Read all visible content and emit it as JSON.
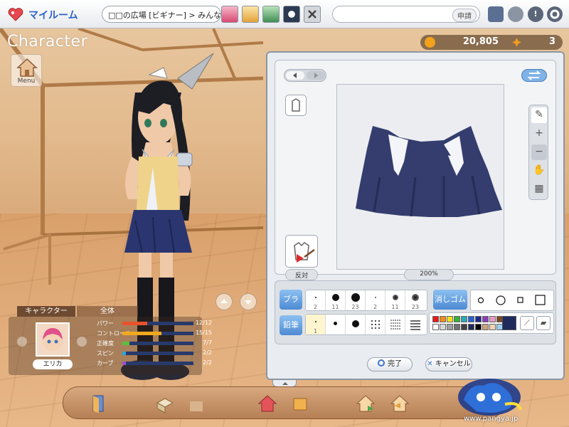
{
  "topbar": {
    "myroom_label": "マイルーム",
    "room_name": "□□の広場 [ビギナー] > みんなで大...",
    "apply_label": "申請"
  },
  "title": "Character",
  "menu_label": "Menu",
  "currency": {
    "pang": "20,805",
    "cookie": "3"
  },
  "editor": {
    "mirror_label": "反対",
    "zoom_label": "200%",
    "brush_tab": "ブラシ",
    "eraser_tab": "消しゴム",
    "pencil_tab": "鉛筆",
    "brush_sizes": [
      "2",
      "11",
      "23",
      "2",
      "11",
      "23"
    ],
    "pencil_sizes": [
      "1"
    ],
    "ok_label": "完了",
    "cancel_label": "キャンセル",
    "palette_colors": [
      "#e41c1c",
      "#f28c1b",
      "#f6e11d",
      "#38b13a",
      "#2aa8b8",
      "#2b5fd0",
      "#1f2a88",
      "#8a3fb8",
      "#e69ac3",
      "#7a4a24",
      "#ffffff",
      "#d8d8d8",
      "#a0a0a0",
      "#707070",
      "#404040",
      "#1f2a5c",
      "#000000",
      "#c9a27a",
      "#f2d3b5",
      "#9bd0ef"
    ],
    "selected_color": "#1f2a5c"
  },
  "stats": {
    "tab_character": "キャラクター",
    "tab_all": "全体",
    "character_name": "エリカ",
    "rows": [
      {
        "label": "パワー",
        "value": "12/12",
        "color": "#e8522c",
        "level": 0.35
      },
      {
        "label": "コントロール",
        "value": "15/15",
        "color": "#f2a91f",
        "level": 0.55
      },
      {
        "label": "正確度",
        "value": "7/7",
        "color": "#5bbf3b",
        "level": 0.1
      },
      {
        "label": "スピン",
        "value": "2/2",
        "color": "#2ba6d6",
        "level": 0.05
      },
      {
        "label": "カーブ",
        "value": "2/2",
        "color": "#9e4fcf",
        "level": 0.05
      }
    ]
  },
  "footer": {
    "url": "www.pangya.jp"
  }
}
